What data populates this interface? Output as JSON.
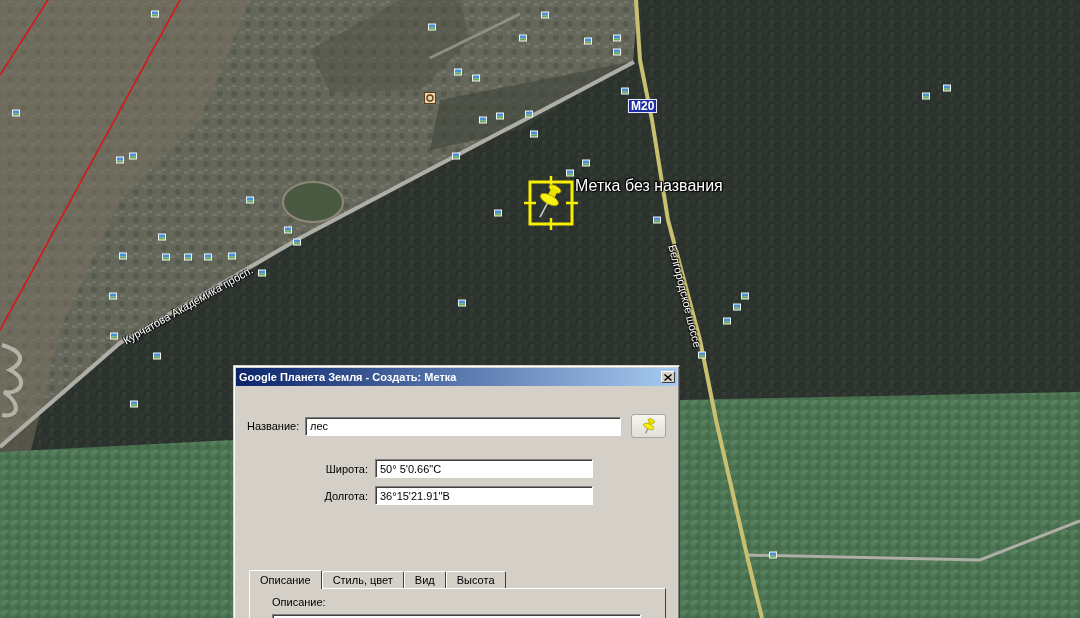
{
  "map": {
    "placemark": {
      "label": "Метка без названия",
      "selected": true
    },
    "route_shield": "M20",
    "road_labels": [
      "Курчатова Академика просп.",
      "Белгородское шоссе"
    ]
  },
  "dialog": {
    "title": "Google Планета Земля - Создать: Метка",
    "name_field": {
      "label": "Название:",
      "value": "лес"
    },
    "coordinates": [
      {
        "label": "Широта:",
        "value": "50° 5'0.66\"С"
      },
      {
        "label": "Долгота:",
        "value": "36°15'21.91\"В"
      }
    ],
    "tabs": [
      {
        "label": "Описание",
        "selected": true
      },
      {
        "label": "Стиль, цвет",
        "selected": false
      },
      {
        "label": "Вид",
        "selected": false
      },
      {
        "label": "Высота",
        "selected": false
      }
    ],
    "description": {
      "label": "Описание:"
    }
  }
}
